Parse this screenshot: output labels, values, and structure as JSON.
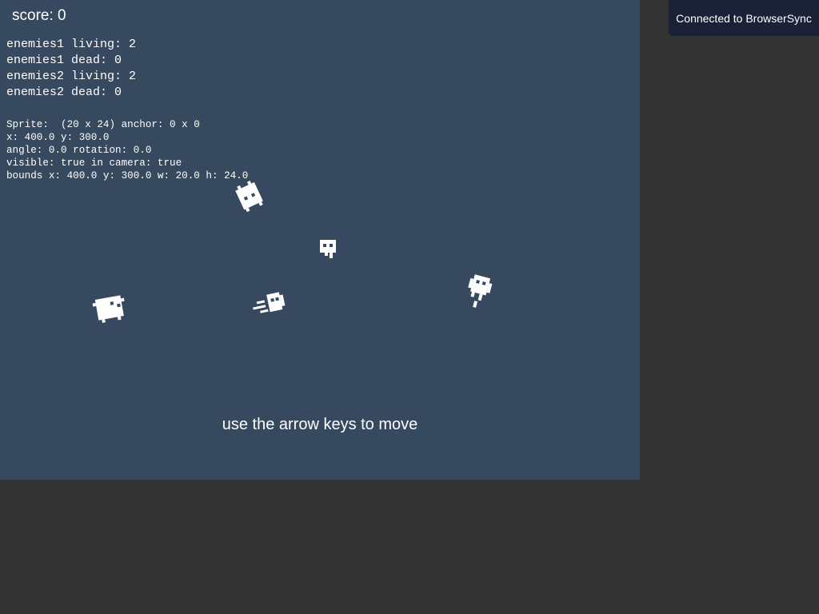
{
  "hud": {
    "score": "score: 0",
    "counters": {
      "enemies1_living": "enemies1 living: 2",
      "enemies1_dead": "enemies1 dead: 0",
      "enemies2_living": "enemies2 living: 2",
      "enemies2_dead": "enemies2 dead: 0"
    },
    "debug": {
      "line1": "Sprite:  (20 x 24) anchor: 0 x 0",
      "line2": "x: 400.0 y: 300.0",
      "line3": "angle: 0.0 rotation: 0.0",
      "line4": "visible: true in camera: true",
      "line5": "bounds x: 400.0 y: 300.0 w: 20.0 h: 24.0"
    },
    "hint": "use the arrow keys to move"
  },
  "notification": {
    "text": "Connected to BrowserSync"
  },
  "colors": {
    "page_background": "#333333",
    "game_background": "#36495f",
    "sprite": "#ffffff",
    "notification_background": "#1b2236"
  }
}
